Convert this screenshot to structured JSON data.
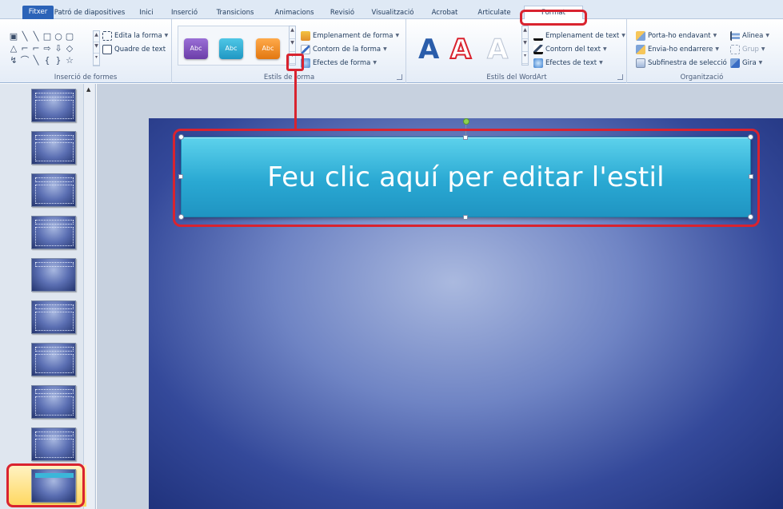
{
  "tabs": [
    {
      "label": "Fitxer"
    },
    {
      "label": "Patró de diapositives"
    },
    {
      "label": "Inici"
    },
    {
      "label": "Inserció"
    },
    {
      "label": "Transicions"
    },
    {
      "label": "Animacions"
    },
    {
      "label": "Revisió"
    },
    {
      "label": "Visualització"
    },
    {
      "label": "Acrobat"
    },
    {
      "label": "Articulate"
    },
    {
      "label": "Format"
    }
  ],
  "ribbon": {
    "insert_shapes": {
      "label": "Inserció de formes",
      "edit_shape": "Edita la forma",
      "text_box": "Quadre de text",
      "shape_glyphs": [
        "▣",
        "╲",
        "╲",
        "□",
        "○",
        "▢",
        "",
        "△",
        "⌐",
        "⌐",
        "⇨",
        "⇩",
        "◇",
        "",
        "↯",
        "⌒",
        "╲",
        "{",
        "}",
        "☆",
        ""
      ]
    },
    "shape_styles": {
      "label": "Estils de forma",
      "style_buttons": [
        "Abc",
        "Abc",
        "Abc"
      ],
      "fill": "Emplenament de forma",
      "outline": "Contorn de la forma",
      "effects": "Efectes de forma"
    },
    "wordart_styles": {
      "label": "Estils del WordArt",
      "letters": [
        "A",
        "A",
        "A"
      ],
      "text_fill": "Emplenament de text",
      "text_outline": "Contorn del text",
      "text_effects": "Efectes de text"
    },
    "arrange": {
      "label": "Organització",
      "bring_forward": "Porta-ho endavant",
      "send_backward": "Envia-ho endarrere",
      "selection_pane": "Subfinestra de selecció",
      "align": "Alinea",
      "group": "Grup",
      "rotate": "Gira"
    }
  },
  "slide": {
    "title": "Feu clic aquí per editar l'estil"
  },
  "colors": {
    "accent_red": "#d9232f",
    "title_fill": "#2aa9d3",
    "file_tab": "#2b63b8",
    "style_purple": "#7a4ab8",
    "style_teal": "#2aa9d3",
    "style_orange": "#f08a1f"
  }
}
